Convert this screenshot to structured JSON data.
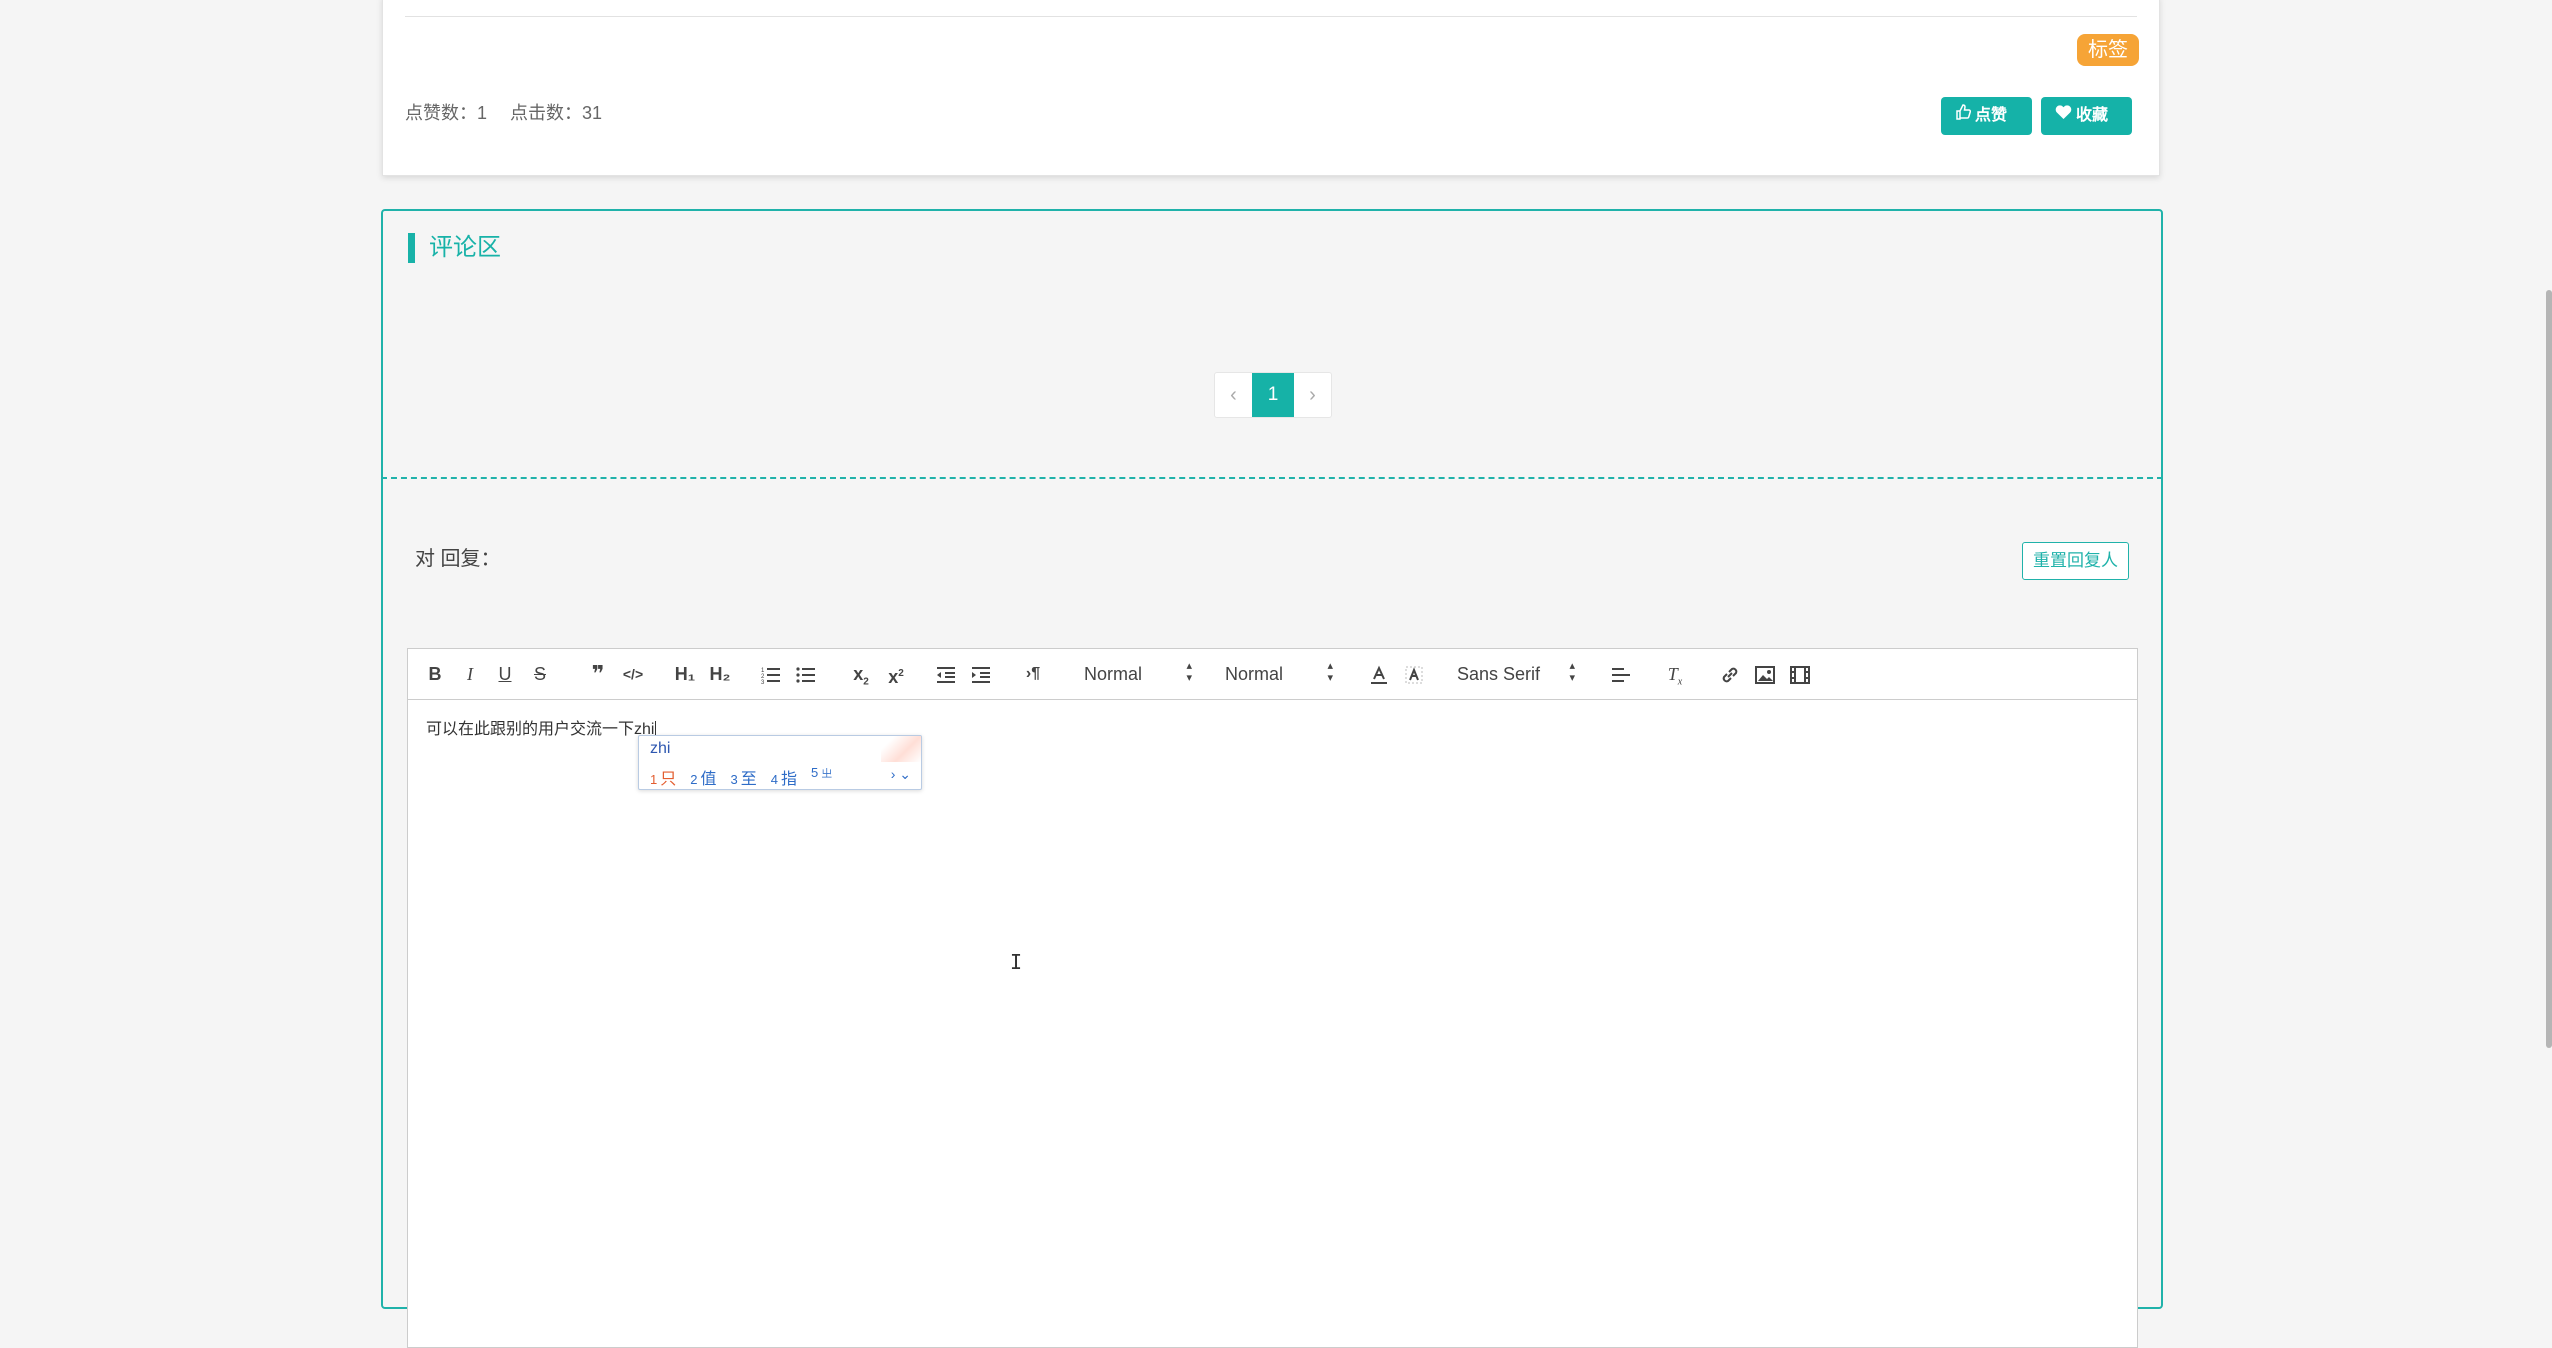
{
  "article": {
    "tag_label": "标签",
    "likes_text": "点赞数：1",
    "clicks_text": "点击数：31",
    "like_button": "点赞",
    "favorite_button": "收藏"
  },
  "comments": {
    "title": "评论区",
    "pagination": {
      "prev": "‹",
      "current": "1",
      "next": "›"
    },
    "reply_to_label": "对 回复：",
    "reset_button": "重置回复人"
  },
  "editor": {
    "toolbar": {
      "header_select": "Normal",
      "size_select": "Normal",
      "font_select": "Sans Serif",
      "h1": "H₁",
      "h2": "H₂"
    },
    "content": "可以在此跟别的用户交流一下zhi"
  },
  "ime": {
    "composition": "zhi",
    "candidates": [
      {
        "num": "1",
        "text": "只"
      },
      {
        "num": "2",
        "text": "值"
      },
      {
        "num": "3",
        "text": "至"
      },
      {
        "num": "4",
        "text": "指"
      },
      {
        "num": "5",
        "text": "㞢"
      }
    ],
    "nav": "› ⌄"
  }
}
